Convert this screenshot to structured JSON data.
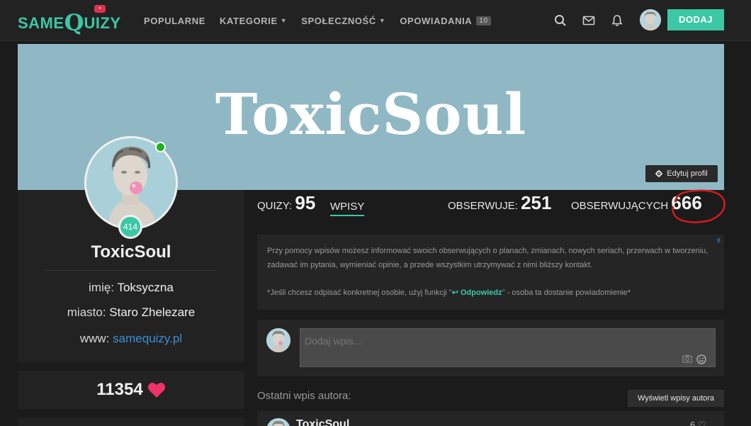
{
  "nav": {
    "logo_same": "SAME",
    "logo_q": "Q",
    "logo_uizy": "UIZY",
    "links": [
      {
        "label": "POPULARNE"
      },
      {
        "label": "KATEGORIE"
      },
      {
        "label": "SPOŁECZNOŚĆ"
      },
      {
        "label": "OPOWIADANIA",
        "count": "10"
      }
    ],
    "add_label": "DODAJ",
    "icons": [
      "search-icon",
      "mail-icon",
      "bell-icon"
    ],
    "accent": "#3cc8a4"
  },
  "banner": {
    "title": "ToxicSoul",
    "background": "#8fb8c4",
    "edit_label": "Edytuj profil"
  },
  "profile": {
    "name": "ToxicSoul",
    "level": "414",
    "online": true,
    "real_name_label": "imię:",
    "real_name": "Toksyczna",
    "city_label": "miasto:",
    "city": "Staro Zhelezare",
    "www_label": "www:",
    "www": "samequizy.pl",
    "likes": "11354"
  },
  "stats": {
    "quizy_label": "QUIZY:",
    "quizy": "95",
    "wpisy_label": "WPISY",
    "obserwuje_label": "OBSERWUJE:",
    "obserwuje": "251",
    "obserwujacych_label": "OBSERWUJĄCYCH",
    "obserwujacych": "666"
  },
  "infobox": {
    "close": "x",
    "text1": "Przy pomocy wpisów możesz informować swoich obserwujących o planach, zmianach, nowych seriach, przerwach w tworzeniu, zadawać im pytania, wymieniać opinie, a przede wszystkim utrzymywać z nimi bliższy kontakt.",
    "text2_pre": "*Jeśli chcesz odpisać konkretnej osobie, użyj funkcji \"",
    "reply_label": "Odpowiedz",
    "text2_post": "\" - osoba ta dostanie powiadomienie*"
  },
  "compose": {
    "placeholder": "Dodaj wpis..."
  },
  "feed": {
    "last_label": "Ostatni wpis autora:",
    "show_label": "Wyświetl wpisy autora",
    "author": "ToxicSoul",
    "likes": "6"
  }
}
